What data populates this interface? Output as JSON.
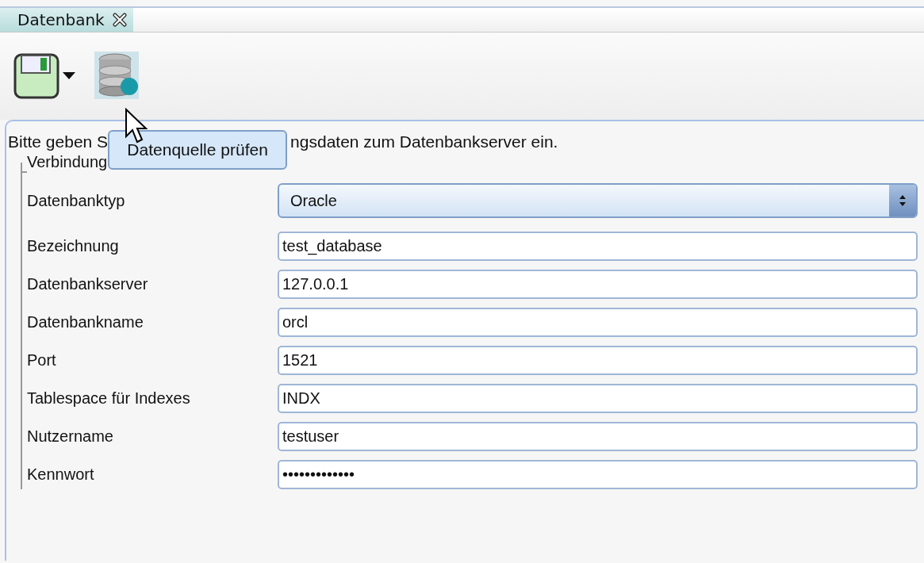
{
  "tabs": [
    {
      "label": "Datenbank",
      "selected": true
    }
  ],
  "toolbar": {
    "tooltip": "Datenquelle prüfen"
  },
  "intro": {
    "before_tooltip": "Bitte geben S",
    "after_tooltip": "ngsdaten zum Datenbankserver ein."
  },
  "group": {
    "legend": "Verbindung"
  },
  "fields": [
    {
      "kind": "select",
      "label": "Datenbanktyp",
      "value": "Oracle"
    },
    {
      "kind": "text",
      "label": "Bezeichnung",
      "value": "test_database"
    },
    {
      "kind": "text",
      "label": "Datenbankserver",
      "value": "127.0.0.1"
    },
    {
      "kind": "text",
      "label": "Datenbankname",
      "value": "orcl"
    },
    {
      "kind": "text",
      "label": "Port",
      "value": "1521"
    },
    {
      "kind": "text",
      "label": "Tablespace für Indexes",
      "value": "INDX"
    },
    {
      "kind": "text",
      "label": "Nutzername",
      "value": "testuser"
    },
    {
      "kind": "password",
      "label": "Kennwort",
      "value": "•••••••••••••"
    }
  ]
}
